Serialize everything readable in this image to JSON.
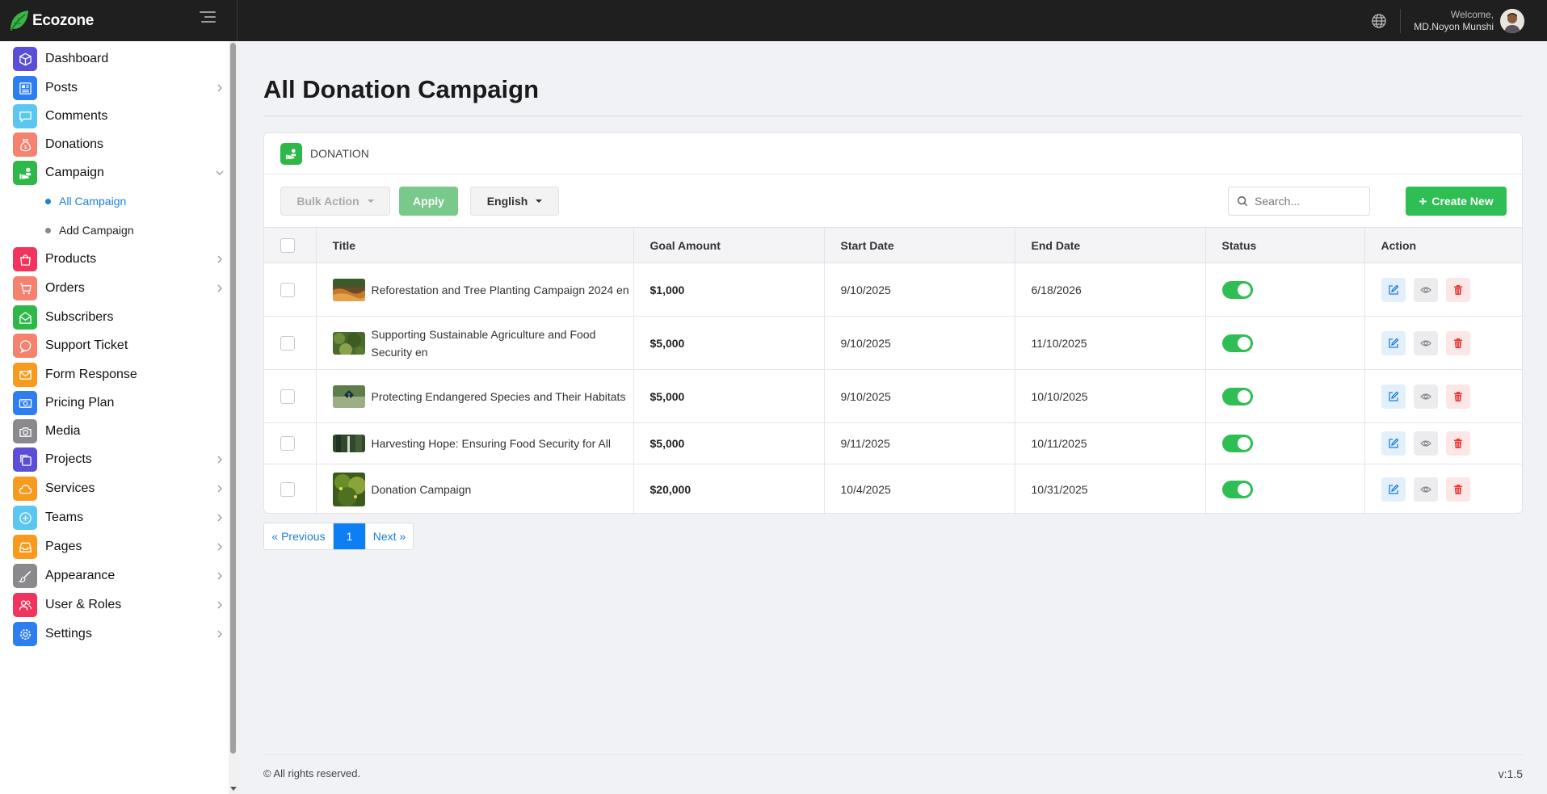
{
  "brand": {
    "name": "Ecozone"
  },
  "header": {
    "welcome": "Welcome,",
    "user_name": "MD.Noyon Munshi"
  },
  "sidebar": {
    "items": [
      {
        "label": "Dashboard",
        "name": "dashboard",
        "icon": "cube-icon",
        "color": "#5a4fd6",
        "has_arrow": false
      },
      {
        "label": "Posts",
        "name": "posts",
        "icon": "newspaper-icon",
        "color": "#2d7ff0",
        "has_arrow": true
      },
      {
        "label": "Comments",
        "name": "comments",
        "icon": "chat-icon",
        "color": "#5bc6f2",
        "has_arrow": false
      },
      {
        "label": "Donations",
        "name": "donations",
        "icon": "money-bag-icon",
        "color": "#f4826f",
        "has_arrow": false
      },
      {
        "label": "Campaign",
        "name": "campaign",
        "icon": "hand-user-icon",
        "color": "#2fb84a",
        "has_arrow": true,
        "expanded": true
      },
      {
        "label": "Products",
        "name": "products",
        "icon": "bag-icon",
        "color": "#f2335d",
        "has_arrow": true
      },
      {
        "label": "Orders",
        "name": "orders",
        "icon": "cart-icon",
        "color": "#f4826f",
        "has_arrow": true
      },
      {
        "label": "Subscribers",
        "name": "subscribers",
        "icon": "envelope-open-icon",
        "color": "#2fb84a",
        "has_arrow": false
      },
      {
        "label": "Support Ticket",
        "name": "support-ticket",
        "icon": "support-chat-icon",
        "color": "#f4826f",
        "has_arrow": false
      },
      {
        "label": "Form Response",
        "name": "form-response",
        "icon": "mail-icon",
        "color": "#f79a1e",
        "has_arrow": false
      },
      {
        "label": "Pricing Plan",
        "name": "pricing-plan",
        "icon": "cash-icon",
        "color": "#2d7ff0",
        "has_arrow": false
      },
      {
        "label": "Media",
        "name": "media",
        "icon": "camera-icon",
        "color": "#8a8a8e",
        "has_arrow": false
      },
      {
        "label": "Projects",
        "name": "projects",
        "icon": "copy-icon",
        "color": "#5a4fd6",
        "has_arrow": true
      },
      {
        "label": "Services",
        "name": "services",
        "icon": "cloud-icon",
        "color": "#f79a1e",
        "has_arrow": true
      },
      {
        "label": "Teams",
        "name": "teams",
        "icon": "plus-circle-icon",
        "color": "#5bc6f2",
        "has_arrow": true
      },
      {
        "label": "Pages",
        "name": "pages",
        "icon": "inbox-icon",
        "color": "#f79a1e",
        "has_arrow": true
      },
      {
        "label": "Appearance",
        "name": "appearance",
        "icon": "brush-icon",
        "color": "#8a8a8e",
        "has_arrow": true
      },
      {
        "label": "User & Roles",
        "name": "user-roles",
        "icon": "users-icon",
        "color": "#f2335d",
        "has_arrow": true
      },
      {
        "label": "Settings",
        "name": "settings",
        "icon": "gear-icon",
        "color": "#2d7ff0",
        "has_arrow": true
      }
    ],
    "sub_items": [
      {
        "label": "All Campaign",
        "active": true
      },
      {
        "label": "Add Campaign",
        "active": false
      }
    ]
  },
  "page": {
    "title": "All Donation Campaign"
  },
  "card": {
    "header": "DONATION"
  },
  "toolbar": {
    "bulk_action": "Bulk Action",
    "apply": "Apply",
    "language": "English",
    "search_placeholder": "Search...",
    "create_new": "Create New"
  },
  "table": {
    "headers": [
      "Title",
      "Goal Amount",
      "Start Date",
      "End Date",
      "Status",
      "Action"
    ],
    "rows": [
      {
        "title": "Reforestation and Tree Planting Campaign 2024 en",
        "goal": "$1,000",
        "start": "9/10/2025",
        "end": "6/18/2026",
        "status_on": true
      },
      {
        "title": "Supporting Sustainable Agriculture and Food Security en",
        "goal": "$5,000",
        "start": "9/10/2025",
        "end": "11/10/2025",
        "status_on": true
      },
      {
        "title": "Protecting Endangered Species and Their Habitats",
        "goal": "$5,000",
        "start": "9/10/2025",
        "end": "10/10/2025",
        "status_on": true
      },
      {
        "title": "Harvesting Hope: Ensuring Food Security for All",
        "goal": "$5,000",
        "start": "9/11/2025",
        "end": "10/11/2025",
        "status_on": true
      },
      {
        "title": "Donation Campaign",
        "goal": "$20,000",
        "start": "10/4/2025",
        "end": "10/31/2025",
        "status_on": true
      }
    ]
  },
  "pagination": {
    "prev": "« Previous",
    "current": "1",
    "next": "Next »"
  },
  "footer": {
    "copyright": "© All rights reserved.",
    "version": "v:1.5"
  }
}
